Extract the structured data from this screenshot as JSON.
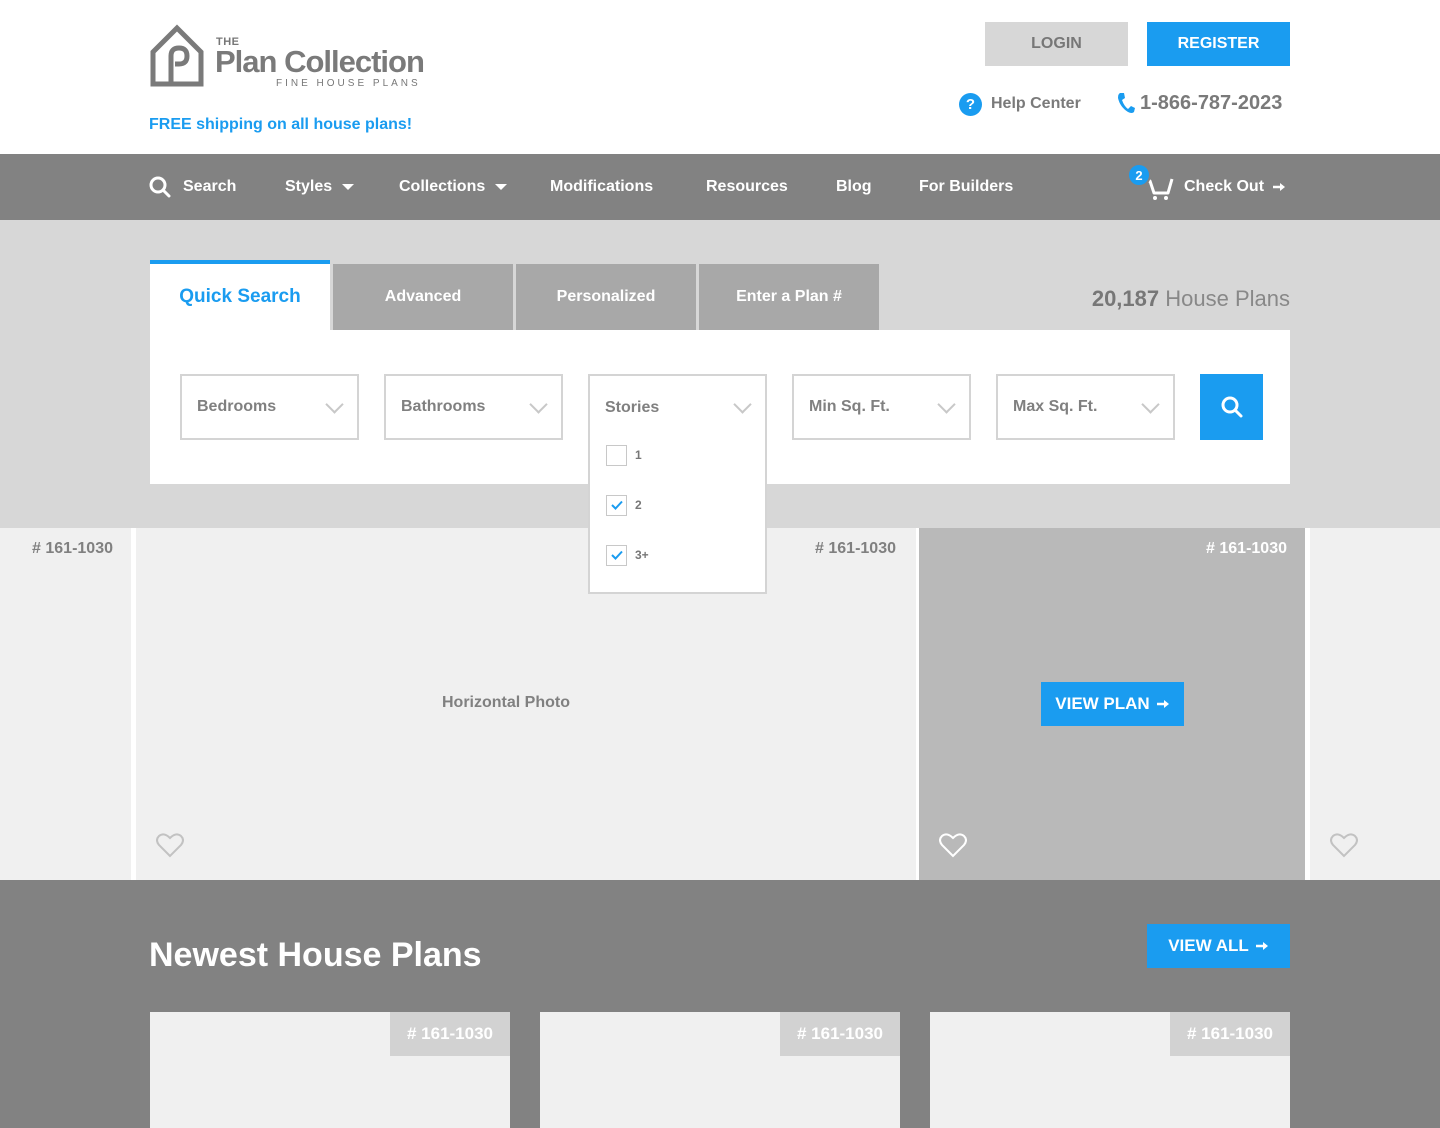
{
  "header": {
    "logo": {
      "the": "THE",
      "name": "Plan Collection",
      "tagline": "FINE HOUSE PLANS"
    },
    "free_shipping": "FREE shipping on all house plans!",
    "login_label": "LOGIN",
    "register_label": "REGISTER",
    "help_label": "Help Center",
    "phone": "1-866-787-2023"
  },
  "nav": {
    "items": [
      {
        "label": "Search"
      },
      {
        "label": "Styles"
      },
      {
        "label": "Collections"
      },
      {
        "label": "Modifications"
      },
      {
        "label": "Resources"
      },
      {
        "label": "Blog"
      },
      {
        "label": "For Builders"
      }
    ],
    "cart_count": "2",
    "checkout_label": "Check Out"
  },
  "search": {
    "tabs": [
      {
        "label": "Quick Search"
      },
      {
        "label": "Advanced"
      },
      {
        "label": "Personalized"
      },
      {
        "label": "Enter a Plan #"
      }
    ],
    "plan_count_number": "20,187",
    "plan_count_label": "House Plans",
    "filters": [
      {
        "label": "Bedrooms"
      },
      {
        "label": "Bathrooms"
      },
      {
        "label": "Stories"
      },
      {
        "label": "Min Sq. Ft."
      },
      {
        "label": "Max Sq. Ft."
      }
    ],
    "stories_options": [
      {
        "label": "1",
        "checked": false
      },
      {
        "label": "2",
        "checked": true
      },
      {
        "label": "3+",
        "checked": true
      }
    ]
  },
  "carousel": {
    "slides": [
      {
        "plan_no": "# 161-1030"
      },
      {
        "plan_no": "# 161-1030",
        "photo_label": "Horizontal Photo"
      },
      {
        "plan_no": "# 161-1030",
        "button": "VIEW PLAN"
      },
      {
        "plan_no": ""
      }
    ]
  },
  "newest": {
    "title": "Newest House Plans",
    "view_all": "VIEW ALL",
    "cards": [
      {
        "plan_no": "# 161-1030"
      },
      {
        "plan_no": "# 161-1030"
      },
      {
        "plan_no": "# 161-1030"
      }
    ]
  },
  "colors": {
    "accent": "#1a9cf0",
    "nav_bg": "#828282",
    "search_bg": "#d7d7d7"
  },
  "icons": [
    "house-logo-icon",
    "question-icon",
    "phone-icon",
    "search-icon",
    "caret-down-icon",
    "cart-icon",
    "arrow-right-icon",
    "chevron-down-icon",
    "check-icon",
    "heart-icon"
  ]
}
